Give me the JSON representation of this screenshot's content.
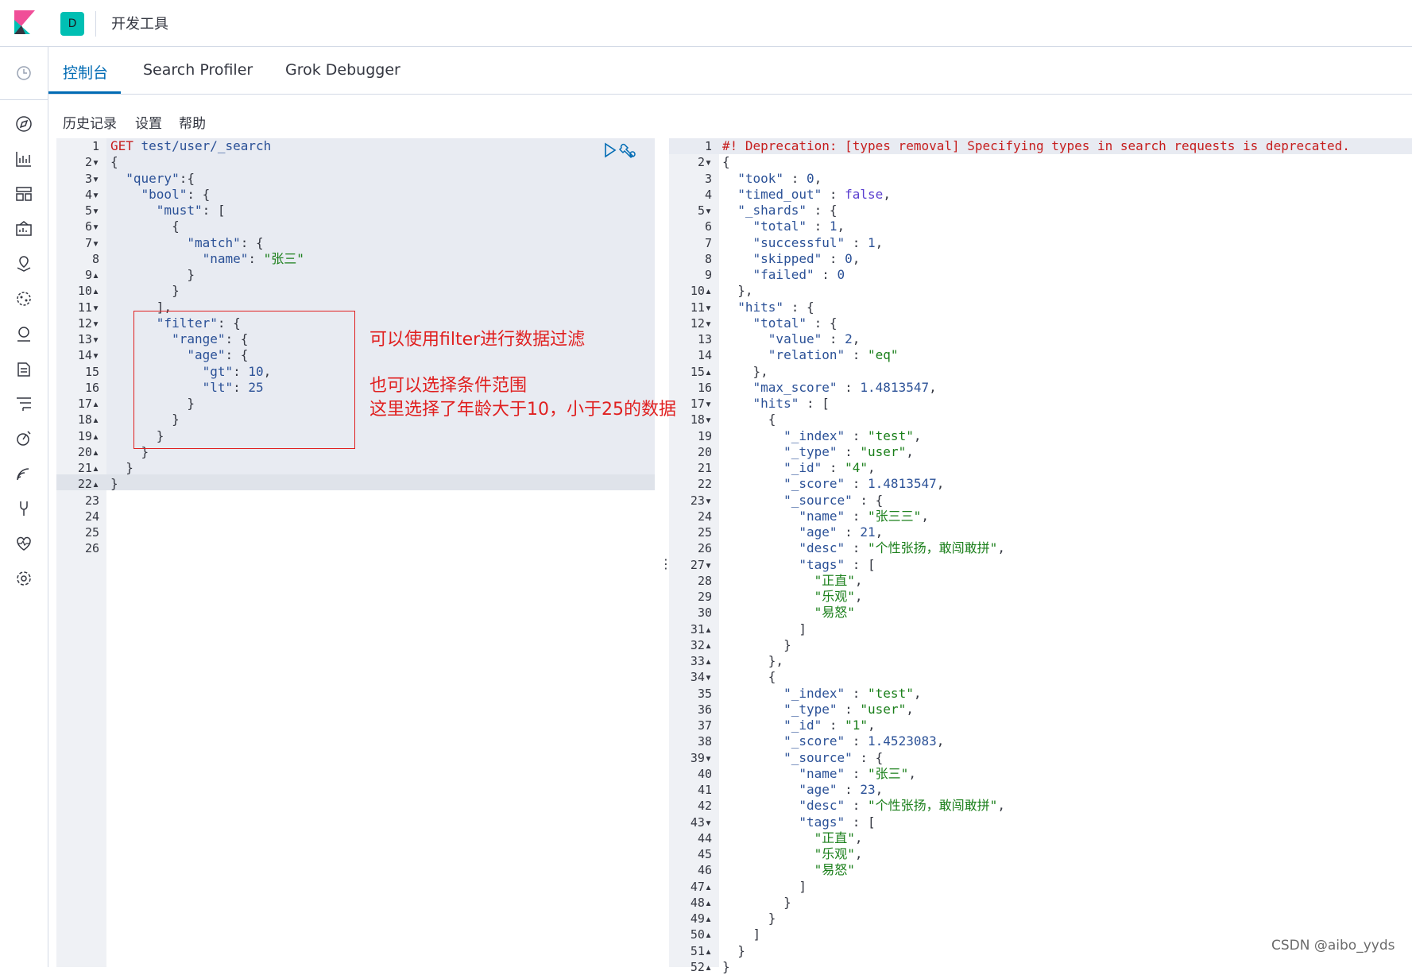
{
  "header": {
    "space_initial": "D",
    "title": "开发工具"
  },
  "tabs": [
    "控制台",
    "Search Profiler",
    "Grok Debugger"
  ],
  "toolbar": {
    "history": "历史记录",
    "settings": "设置",
    "help": "帮助"
  },
  "annotation": {
    "line1": "可以使用filter进行数据过滤",
    "line2": "也可以选择条件范围",
    "line3": "这里选择了年龄大于10，小于25的数据"
  },
  "watermark": "CSDN @aibo_yyds",
  "request_lines": [
    [
      [
        "m",
        "GET "
      ],
      [
        "k",
        "test/user/_search"
      ]
    ],
    [
      [
        "p",
        "{"
      ]
    ],
    [
      [
        "p",
        "  "
      ],
      [
        "k",
        "\"query\""
      ],
      [
        "p",
        ":{"
      ]
    ],
    [
      [
        "p",
        "    "
      ],
      [
        "k",
        "\"bool\""
      ],
      [
        "p",
        ": {"
      ]
    ],
    [
      [
        "p",
        "      "
      ],
      [
        "k",
        "\"must\""
      ],
      [
        "p",
        ": ["
      ]
    ],
    [
      [
        "p",
        "        {"
      ]
    ],
    [
      [
        "p",
        "          "
      ],
      [
        "k",
        "\"match\""
      ],
      [
        "p",
        ": {"
      ]
    ],
    [
      [
        "p",
        "            "
      ],
      [
        "k",
        "\"name\""
      ],
      [
        "p",
        ": "
      ],
      [
        "s",
        "\"张三\""
      ]
    ],
    [
      [
        "p",
        "          }"
      ]
    ],
    [
      [
        "p",
        "        }"
      ]
    ],
    [
      [
        "p",
        "      ],"
      ]
    ],
    [
      [
        "p",
        "      "
      ],
      [
        "k",
        "\"filter\""
      ],
      [
        "p",
        ": {"
      ]
    ],
    [
      [
        "p",
        "        "
      ],
      [
        "k",
        "\"range\""
      ],
      [
        "p",
        ": {"
      ]
    ],
    [
      [
        "p",
        "          "
      ],
      [
        "k",
        "\"age\""
      ],
      [
        "p",
        ": {"
      ]
    ],
    [
      [
        "p",
        "            "
      ],
      [
        "k",
        "\"gt\""
      ],
      [
        "p",
        ": "
      ],
      [
        "n",
        "10"
      ],
      [
        "p",
        ","
      ]
    ],
    [
      [
        "p",
        "            "
      ],
      [
        "k",
        "\"lt\""
      ],
      [
        "p",
        ": "
      ],
      [
        "n",
        "25"
      ]
    ],
    [
      [
        "p",
        "          }"
      ]
    ],
    [
      [
        "p",
        "        }"
      ]
    ],
    [
      [
        "p",
        "      }"
      ]
    ],
    [
      [
        "p",
        "    }"
      ]
    ],
    [
      [
        "p",
        "  }"
      ]
    ],
    [
      [
        "p",
        "}"
      ]
    ],
    [],
    [],
    [],
    []
  ],
  "response_lines": [
    [
      [
        "m",
        "#! Deprecation: [types removal] Specifying types in search requests is deprecated."
      ]
    ],
    [
      [
        "p",
        "{"
      ]
    ],
    [
      [
        "p",
        "  "
      ],
      [
        "k",
        "\"took\""
      ],
      [
        "p",
        " : "
      ],
      [
        "n",
        "0"
      ],
      [
        "p",
        ","
      ]
    ],
    [
      [
        "p",
        "  "
      ],
      [
        "k",
        "\"timed_out\""
      ],
      [
        "p",
        " : "
      ],
      [
        "b",
        "false"
      ],
      [
        "p",
        ","
      ]
    ],
    [
      [
        "p",
        "  "
      ],
      [
        "k",
        "\"_shards\""
      ],
      [
        "p",
        " : {"
      ]
    ],
    [
      [
        "p",
        "    "
      ],
      [
        "k",
        "\"total\""
      ],
      [
        "p",
        " : "
      ],
      [
        "n",
        "1"
      ],
      [
        "p",
        ","
      ]
    ],
    [
      [
        "p",
        "    "
      ],
      [
        "k",
        "\"successful\""
      ],
      [
        "p",
        " : "
      ],
      [
        "n",
        "1"
      ],
      [
        "p",
        ","
      ]
    ],
    [
      [
        "p",
        "    "
      ],
      [
        "k",
        "\"skipped\""
      ],
      [
        "p",
        " : "
      ],
      [
        "n",
        "0"
      ],
      [
        "p",
        ","
      ]
    ],
    [
      [
        "p",
        "    "
      ],
      [
        "k",
        "\"failed\""
      ],
      [
        "p",
        " : "
      ],
      [
        "n",
        "0"
      ]
    ],
    [
      [
        "p",
        "  },"
      ]
    ],
    [
      [
        "p",
        "  "
      ],
      [
        "k",
        "\"hits\""
      ],
      [
        "p",
        " : {"
      ]
    ],
    [
      [
        "p",
        "    "
      ],
      [
        "k",
        "\"total\""
      ],
      [
        "p",
        " : {"
      ]
    ],
    [
      [
        "p",
        "      "
      ],
      [
        "k",
        "\"value\""
      ],
      [
        "p",
        " : "
      ],
      [
        "n",
        "2"
      ],
      [
        "p",
        ","
      ]
    ],
    [
      [
        "p",
        "      "
      ],
      [
        "k",
        "\"relation\""
      ],
      [
        "p",
        " : "
      ],
      [
        "s",
        "\"eq\""
      ]
    ],
    [
      [
        "p",
        "    },"
      ]
    ],
    [
      [
        "p",
        "    "
      ],
      [
        "k",
        "\"max_score\""
      ],
      [
        "p",
        " : "
      ],
      [
        "n",
        "1.4813547"
      ],
      [
        "p",
        ","
      ]
    ],
    [
      [
        "p",
        "    "
      ],
      [
        "k",
        "\"hits\""
      ],
      [
        "p",
        " : ["
      ]
    ],
    [
      [
        "p",
        "      {"
      ]
    ],
    [
      [
        "p",
        "        "
      ],
      [
        "k",
        "\"_index\""
      ],
      [
        "p",
        " : "
      ],
      [
        "s",
        "\"test\""
      ],
      [
        "p",
        ","
      ]
    ],
    [
      [
        "p",
        "        "
      ],
      [
        "k",
        "\"_type\""
      ],
      [
        "p",
        " : "
      ],
      [
        "s",
        "\"user\""
      ],
      [
        "p",
        ","
      ]
    ],
    [
      [
        "p",
        "        "
      ],
      [
        "k",
        "\"_id\""
      ],
      [
        "p",
        " : "
      ],
      [
        "s",
        "\"4\""
      ],
      [
        "p",
        ","
      ]
    ],
    [
      [
        "p",
        "        "
      ],
      [
        "k",
        "\"_score\""
      ],
      [
        "p",
        " : "
      ],
      [
        "n",
        "1.4813547"
      ],
      [
        "p",
        ","
      ]
    ],
    [
      [
        "p",
        "        "
      ],
      [
        "k",
        "\"_source\""
      ],
      [
        "p",
        " : {"
      ]
    ],
    [
      [
        "p",
        "          "
      ],
      [
        "k",
        "\"name\""
      ],
      [
        "p",
        " : "
      ],
      [
        "s",
        "\"张三三\""
      ],
      [
        "p",
        ","
      ]
    ],
    [
      [
        "p",
        "          "
      ],
      [
        "k",
        "\"age\""
      ],
      [
        "p",
        " : "
      ],
      [
        "n",
        "21"
      ],
      [
        "p",
        ","
      ]
    ],
    [
      [
        "p",
        "          "
      ],
      [
        "k",
        "\"desc\""
      ],
      [
        "p",
        " : "
      ],
      [
        "s",
        "\"个性张扬，敢闯敢拼\""
      ],
      [
        "p",
        ","
      ]
    ],
    [
      [
        "p",
        "          "
      ],
      [
        "k",
        "\"tags\""
      ],
      [
        "p",
        " : ["
      ]
    ],
    [
      [
        "p",
        "            "
      ],
      [
        "s",
        "\"正直\""
      ],
      [
        "p",
        ","
      ]
    ],
    [
      [
        "p",
        "            "
      ],
      [
        "s",
        "\"乐观\""
      ],
      [
        "p",
        ","
      ]
    ],
    [
      [
        "p",
        "            "
      ],
      [
        "s",
        "\"易怒\""
      ]
    ],
    [
      [
        "p",
        "          ]"
      ]
    ],
    [
      [
        "p",
        "        }"
      ]
    ],
    [
      [
        "p",
        "      },"
      ]
    ],
    [
      [
        "p",
        "      {"
      ]
    ],
    [
      [
        "p",
        "        "
      ],
      [
        "k",
        "\"_index\""
      ],
      [
        "p",
        " : "
      ],
      [
        "s",
        "\"test\""
      ],
      [
        "p",
        ","
      ]
    ],
    [
      [
        "p",
        "        "
      ],
      [
        "k",
        "\"_type\""
      ],
      [
        "p",
        " : "
      ],
      [
        "s",
        "\"user\""
      ],
      [
        "p",
        ","
      ]
    ],
    [
      [
        "p",
        "        "
      ],
      [
        "k",
        "\"_id\""
      ],
      [
        "p",
        " : "
      ],
      [
        "s",
        "\"1\""
      ],
      [
        "p",
        ","
      ]
    ],
    [
      [
        "p",
        "        "
      ],
      [
        "k",
        "\"_score\""
      ],
      [
        "p",
        " : "
      ],
      [
        "n",
        "1.4523083"
      ],
      [
        "p",
        ","
      ]
    ],
    [
      [
        "p",
        "        "
      ],
      [
        "k",
        "\"_source\""
      ],
      [
        "p",
        " : {"
      ]
    ],
    [
      [
        "p",
        "          "
      ],
      [
        "k",
        "\"name\""
      ],
      [
        "p",
        " : "
      ],
      [
        "s",
        "\"张三\""
      ],
      [
        "p",
        ","
      ]
    ],
    [
      [
        "p",
        "          "
      ],
      [
        "k",
        "\"age\""
      ],
      [
        "p",
        " : "
      ],
      [
        "n",
        "23"
      ],
      [
        "p",
        ","
      ]
    ],
    [
      [
        "p",
        "          "
      ],
      [
        "k",
        "\"desc\""
      ],
      [
        "p",
        " : "
      ],
      [
        "s",
        "\"个性张扬，敢闯敢拼\""
      ],
      [
        "p",
        ","
      ]
    ],
    [
      [
        "p",
        "          "
      ],
      [
        "k",
        "\"tags\""
      ],
      [
        "p",
        " : ["
      ]
    ],
    [
      [
        "p",
        "            "
      ],
      [
        "s",
        "\"正直\""
      ],
      [
        "p",
        ","
      ]
    ],
    [
      [
        "p",
        "            "
      ],
      [
        "s",
        "\"乐观\""
      ],
      [
        "p",
        ","
      ]
    ],
    [
      [
        "p",
        "            "
      ],
      [
        "s",
        "\"易怒\""
      ]
    ],
    [
      [
        "p",
        "          ]"
      ]
    ],
    [
      [
        "p",
        "        }"
      ]
    ],
    [
      [
        "p",
        "      }"
      ]
    ],
    [
      [
        "p",
        "    ]"
      ]
    ],
    [
      [
        "p",
        "  }"
      ]
    ],
    [
      [
        "p",
        "}"
      ]
    ]
  ],
  "request_folds": {
    "2": "down",
    "3": "down",
    "4": "down",
    "5": "down",
    "6": "down",
    "7": "down",
    "9": "up",
    "10": "up",
    "11": "down",
    "12": "down",
    "13": "down",
    "14": "down",
    "17": "up",
    "18": "up",
    "19": "up",
    "20": "up",
    "21": "up",
    "22": "up"
  },
  "response_folds": {
    "2": "down",
    "5": "down",
    "10": "up",
    "11": "down",
    "12": "down",
    "15": "up",
    "17": "down",
    "18": "down",
    "23": "down",
    "27": "down",
    "31": "up",
    "32": "up",
    "33": "up",
    "34": "down",
    "39": "down",
    "43": "down",
    "47": "up",
    "48": "up",
    "49": "up",
    "50": "up",
    "51": "up",
    "52": "up"
  }
}
